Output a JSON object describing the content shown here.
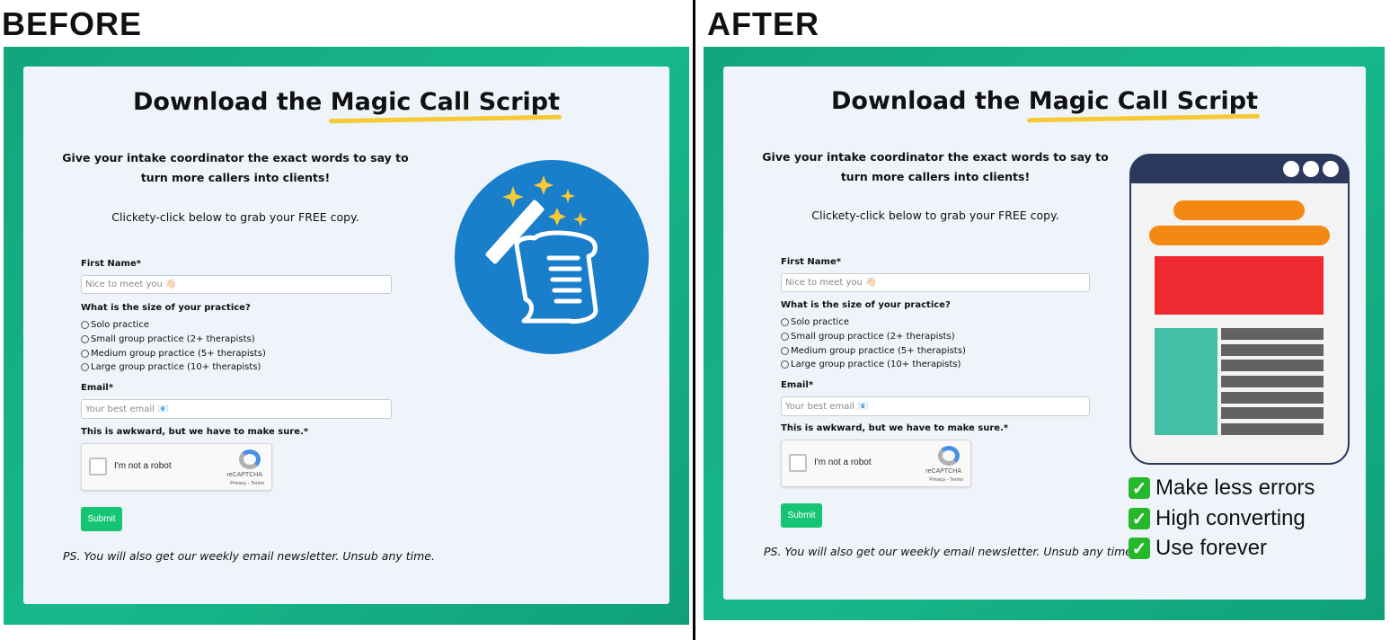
{
  "labels": {
    "before": "BEFORE",
    "after": "AFTER"
  },
  "colors": {
    "frame": "#13a57d",
    "card": "#eef4f9",
    "highlight": "#f7c934",
    "submit": "#16c574",
    "circle": "#1a7fcb"
  },
  "before": {
    "title_pre": "Download the",
    "title_hl": "Magic Call Script",
    "desc_line1": "Give your intake coordinator the exact words to say to",
    "desc_line2": "turn more callers into clients!",
    "cta": "Clickety-click below to grab your FREE copy.",
    "first_name_label": "First Name*",
    "first_name_placeholder": "Nice to meet you 👋🏻",
    "question": "What is the size of your practice?",
    "options": [
      "Solo practice",
      "Small group practice (2+ therapists)",
      "Medium group practice (5+ therapists)",
      "Large group practice (10+ therapists)"
    ],
    "email_label": "Email*",
    "email_placeholder": "Your best email 📧",
    "captcha_label": "This is awkward, but we have to make sure.*",
    "captcha_text": "I'm not a robot",
    "captcha_brand": "reCAPTCHA",
    "captcha_links": "Privacy - Terms",
    "submit": "Submit",
    "ps": "PS. You will also get our weekly email newsletter. Unsub any time.",
    "image_icon": "magic-wand-scroll-icon"
  },
  "after": {
    "title_pre": "Download the",
    "title_hl": "Magic Call Script",
    "desc_line1": "Give your intake coordinator the exact words to say to",
    "desc_line2": "turn more callers into clients!",
    "cta": "Clickety-click below to grab your FREE copy.",
    "first_name_label": "First Name*",
    "first_name_placeholder": "Nice to meet you 👋🏻",
    "question": "What is the size of your practice?",
    "options": [
      "Solo practice",
      "Small group practice (2+ therapists)",
      "Medium group practice (5+ therapists)",
      "Large group practice (10+ therapists)"
    ],
    "email_label": "Email*",
    "email_placeholder": "Your best email 📧",
    "captcha_label": "This is awkward, but we have to make sure.*",
    "captcha_text": "I'm not a robot",
    "captcha_brand": "reCAPTCHA",
    "captcha_links": "Privacy - Terms",
    "submit": "Submit",
    "ps": "PS. You will also get our weekly email newsletter. Unsub any time.",
    "image_icon": "webpage-mockup-icon",
    "benefits": [
      "Make less errors",
      "High converting",
      "Use forever"
    ]
  }
}
